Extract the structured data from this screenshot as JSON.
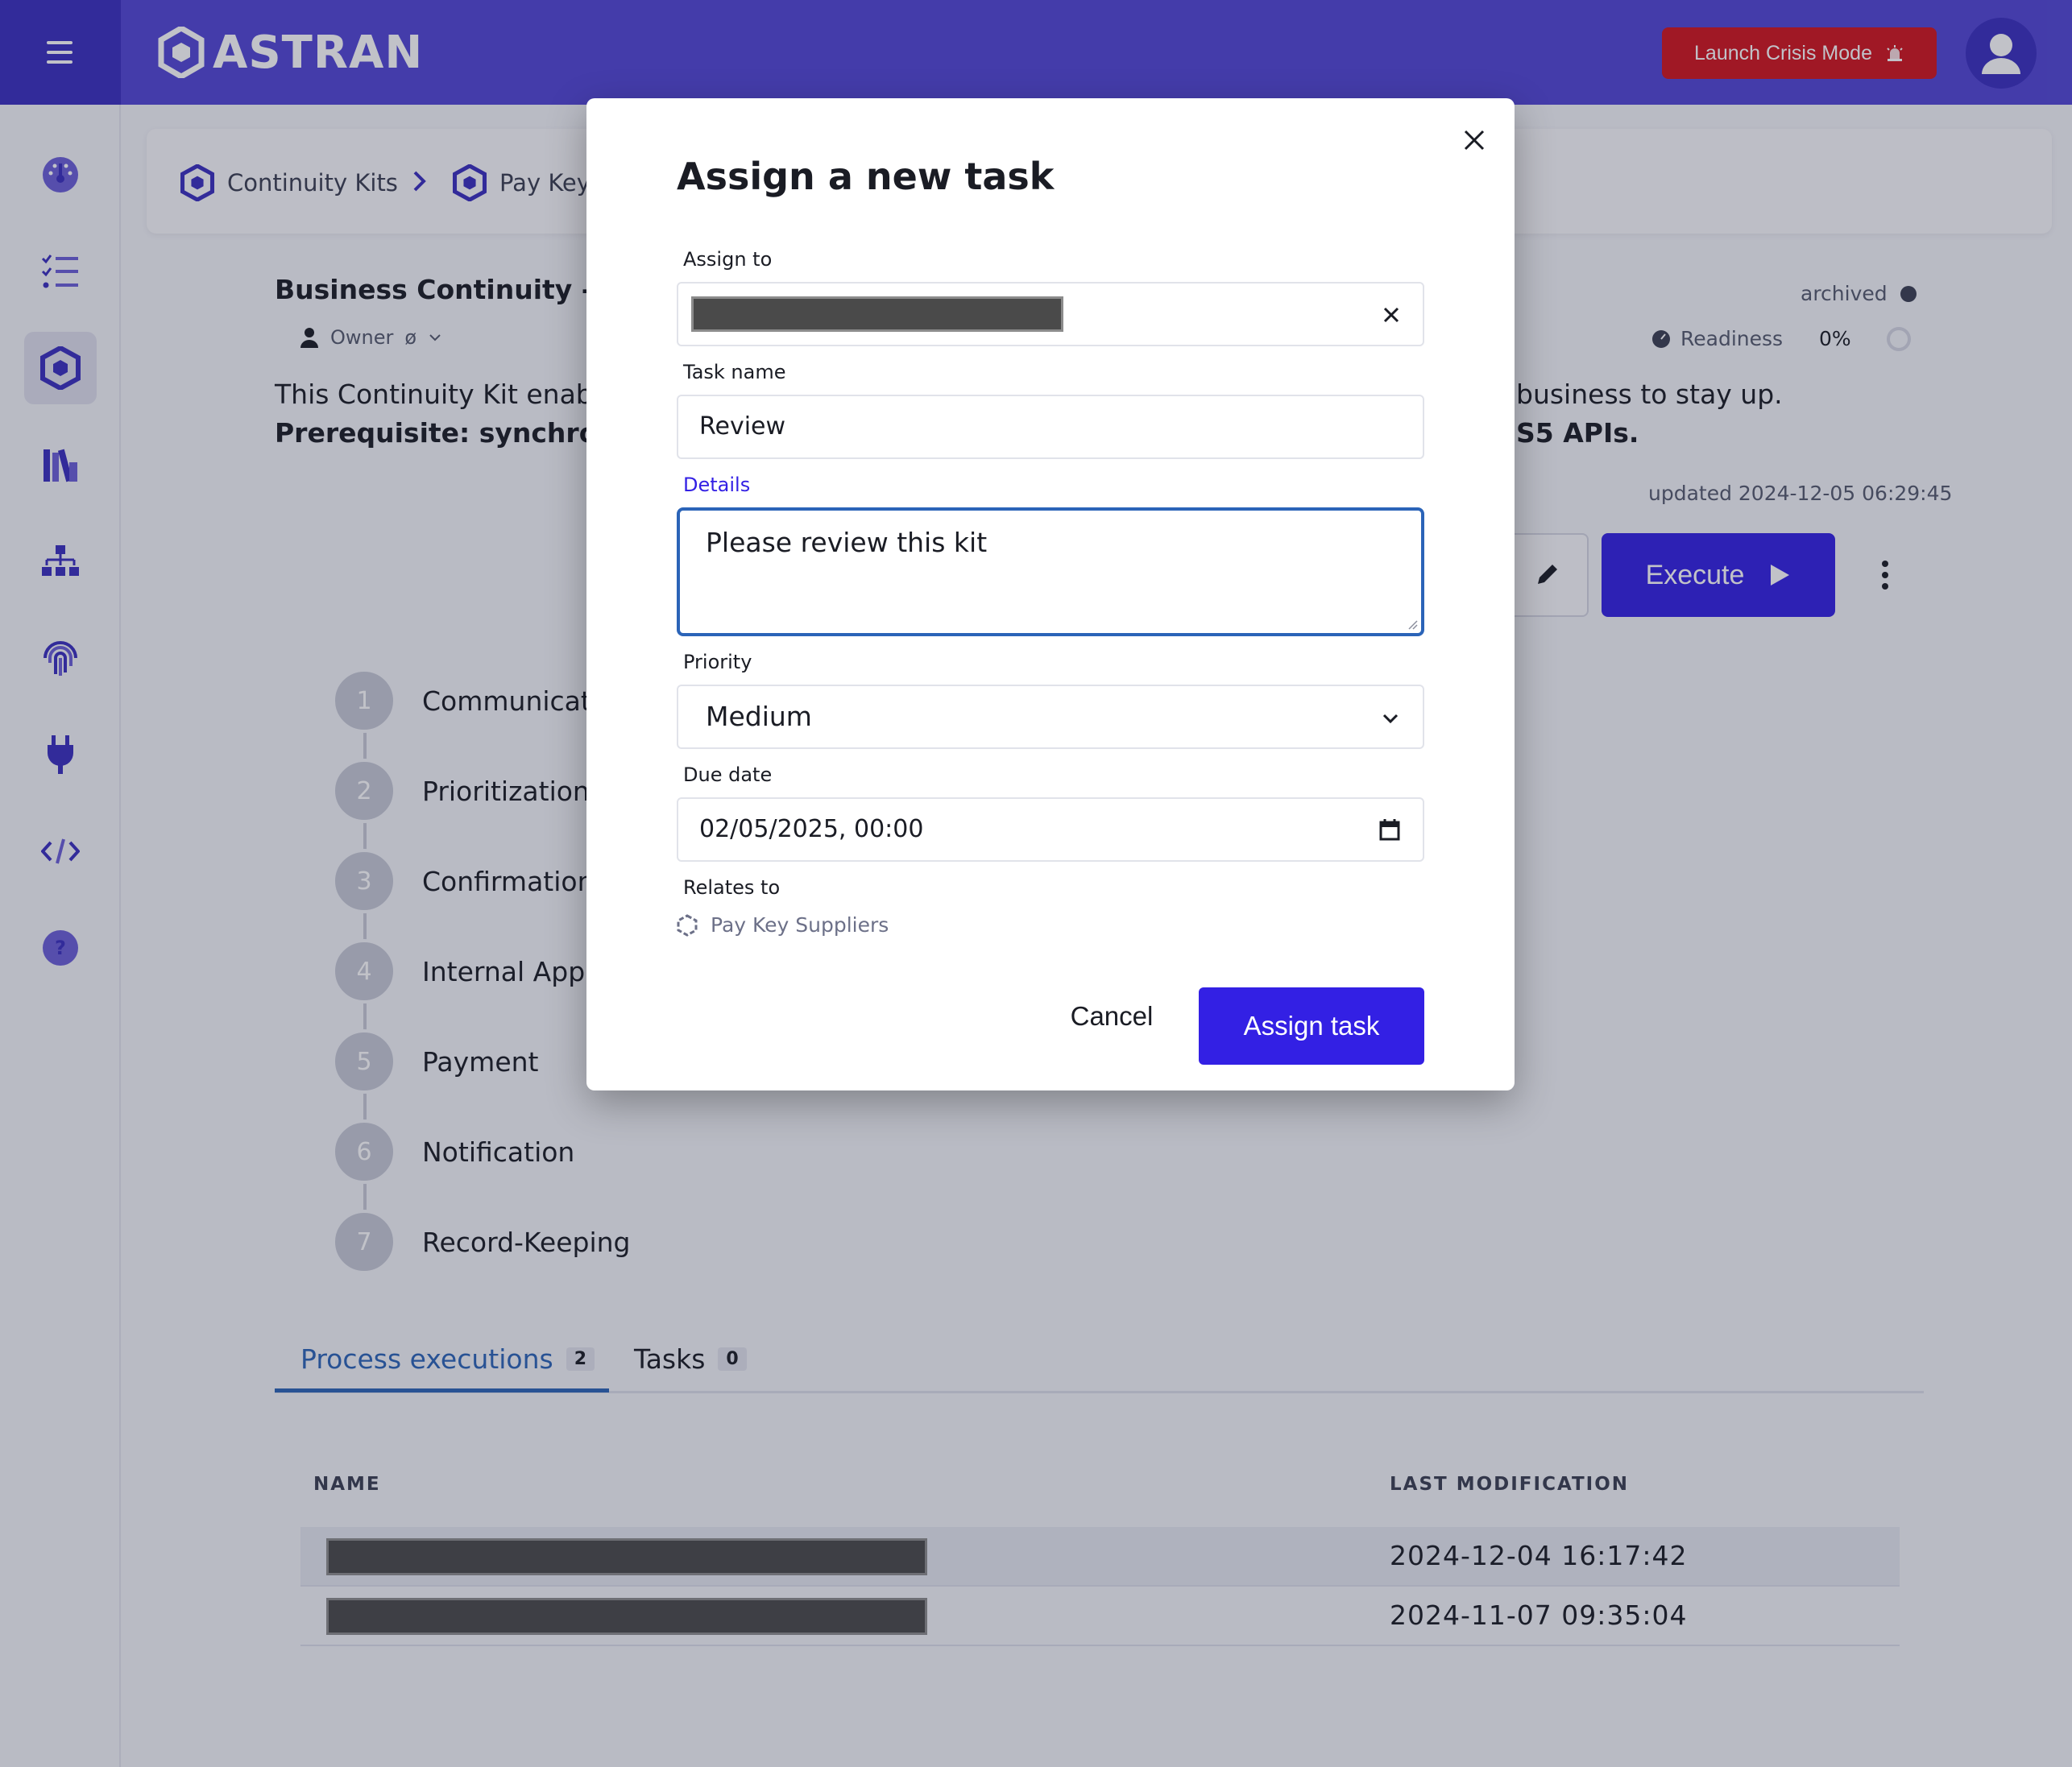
{
  "app": {
    "name": "ASTRAN"
  },
  "topbar": {
    "crisis_button": "Launch Crisis Mode"
  },
  "breadcrumb": {
    "items": [
      "Continuity Kits",
      "Pay Key"
    ]
  },
  "kit": {
    "title": "Business Continuity - Pa",
    "owner_label": "Owner",
    "owner_value": "ø",
    "status": "archived",
    "readiness_label": "Readiness",
    "readiness_value": "0%",
    "description_left": "This Continuity Kit enabl",
    "description_right": "business to stay up.",
    "prereq_left": "Prerequisite: synchronis",
    "prereq_right": "S5 APIs.",
    "updated": "updated 2024-12-05 06:29:45",
    "execute_label": "Execute"
  },
  "steps": [
    {
      "num": "1",
      "label": "Communicat"
    },
    {
      "num": "2",
      "label": "Prioritization"
    },
    {
      "num": "3",
      "label": "Confirmation"
    },
    {
      "num": "4",
      "label": "Internal App"
    },
    {
      "num": "5",
      "label": "Payment"
    },
    {
      "num": "6",
      "label": "Notification"
    },
    {
      "num": "7",
      "label": "Record-Keeping"
    }
  ],
  "tabs": [
    {
      "label": "Process executions",
      "count": "2"
    },
    {
      "label": "Tasks",
      "count": "0"
    }
  ],
  "table": {
    "headers": [
      "NAME",
      "LAST MODIFICATION"
    ],
    "rows": [
      {
        "date": "2024-12-04 16:17:42"
      },
      {
        "date": "2024-11-07 09:35:04"
      }
    ]
  },
  "modal": {
    "title": "Assign a new task",
    "assign_to_label": "Assign to",
    "task_name_label": "Task name",
    "task_name_value": "Review",
    "details_label": "Details",
    "details_value": "Please review this kit",
    "priority_label": "Priority",
    "priority_value": "Medium",
    "due_date_label": "Due date",
    "due_date_value": "02/05/2025, 00:00",
    "relates_label": "Relates to",
    "relates_value": "Pay Key Suppliers",
    "cancel_label": "Cancel",
    "submit_label": "Assign task"
  },
  "colors": {
    "brand": "#5246d6",
    "brand_dark": "#3a2ec0",
    "primary_button": "#3320e4",
    "crisis": "#d2141e",
    "focus": "#2b64b8"
  }
}
